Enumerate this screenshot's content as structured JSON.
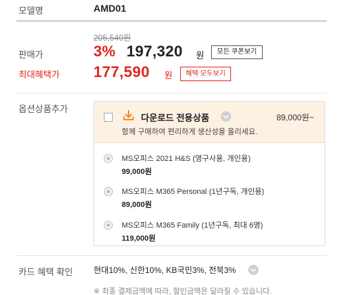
{
  "model": {
    "label": "모델명",
    "value": "AMD01"
  },
  "price": {
    "original": "205,540원",
    "label": "판매가",
    "discount_rate": "3%",
    "sale_price": "197,320",
    "unit": "원",
    "coupon_button": "모든 쿠폰보기"
  },
  "benefit": {
    "label": "최대혜택가",
    "price": "177,590",
    "unit": "원",
    "button": "혜택 모두보기"
  },
  "options": {
    "label": "옵션상품추가",
    "header_title": "다운로드 전용상품",
    "header_price": "89,000원~",
    "header_desc": "함께 구매하여 편리하게 생산성을 올리세요.",
    "items": [
      {
        "name": "MS오피스 2021 H&S (영구사용, 개인용)",
        "price": "99,000원"
      },
      {
        "name": "MS오피스 M365 Personal (1년구독, 개인용)",
        "price": "89,000원"
      },
      {
        "name": "MS오피스 M365 Family (1년구독, 최대 6명)",
        "price": "119,000원"
      }
    ]
  },
  "card": {
    "label": "카드 혜택 확인",
    "value": "현대10%, 신한10%, KB국민3%, 전북3%",
    "note": "※ 최종 결제금액에 따라, 할인금액은 달라질 수 있습니다."
  },
  "colors": {
    "accent_red": "#e0261d",
    "option_header_bg": "#fdf1e4",
    "download_icon": "#f08c1e"
  },
  "icons": {
    "download": "download-icon",
    "chevron": "chevron-down-icon"
  }
}
